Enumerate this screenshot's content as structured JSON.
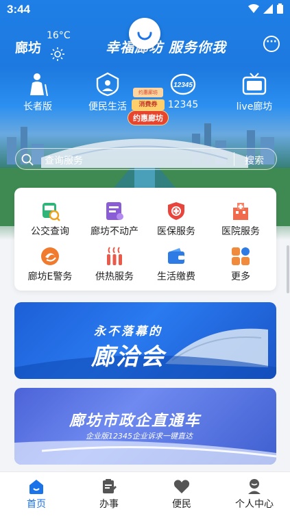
{
  "status_bar": {
    "time": "3:44"
  },
  "header": {
    "city": "廊坊",
    "temperature": "16°C",
    "slogan": "幸福廊坊 服务你我"
  },
  "quick_links": [
    {
      "label": "长者版",
      "icon": "elderly-icon"
    },
    {
      "label": "便民生活",
      "icon": "service-heart-icon"
    },
    {
      "label": "12345",
      "icon": "hotline-12345-icon"
    },
    {
      "label": "live廊坊",
      "icon": "tv-icon"
    }
  ],
  "coupon": {
    "top": "约惠廊坊",
    "mid": "消费券",
    "button": "约惠廊坊"
  },
  "search": {
    "placeholder": "查询服务",
    "button": "搜索"
  },
  "services": [
    {
      "label": "公交查询",
      "icon": "bus-icon",
      "color": "#2fb57a"
    },
    {
      "label": "廊坊不动产",
      "icon": "property-icon",
      "color": "#8a5cd6"
    },
    {
      "label": "医保服务",
      "icon": "medical-insurance-icon",
      "color": "#e8453c"
    },
    {
      "label": "医院服务",
      "icon": "hospital-icon",
      "color": "#f06a4e"
    },
    {
      "label": "廊坊E警务",
      "icon": "police-icon",
      "color": "#f07a2e"
    },
    {
      "label": "供热服务",
      "icon": "heating-icon",
      "color": "#ea5a4a"
    },
    {
      "label": "生活缴费",
      "icon": "wallet-icon",
      "color": "#2e7be6"
    },
    {
      "label": "更多",
      "icon": "more-grid-icon",
      "color": "#f08a3c"
    }
  ],
  "banners": [
    {
      "top_text": "永不落幕的",
      "main_text": "廊洽会"
    },
    {
      "main_text": "廊坊市政企直通车",
      "sub_text": "企业版12345企业诉求一键直达"
    }
  ],
  "tabs": [
    {
      "label": "首页",
      "icon": "home-icon",
      "active": true
    },
    {
      "label": "办事",
      "icon": "clipboard-icon",
      "active": false
    },
    {
      "label": "便民",
      "icon": "heart-icon",
      "active": false
    },
    {
      "label": "个人中心",
      "icon": "user-icon",
      "active": false
    }
  ],
  "colors": {
    "primary": "#1a73e8",
    "hero": "#1f7fe6"
  }
}
